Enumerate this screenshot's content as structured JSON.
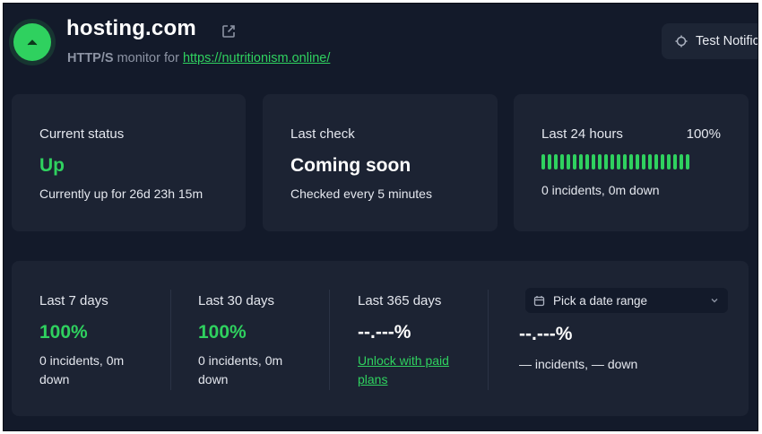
{
  "header": {
    "title": "hosting.com",
    "monitor_type": "HTTP/S",
    "monitor_for": "monitor for",
    "url": "https://nutritionism.online/",
    "test_button_label": "Test Notific"
  },
  "colors": {
    "up_green": "#2fd15f",
    "background": "#131a2a",
    "card": "#1c2333"
  },
  "icons": {
    "status": "chevron-up-icon",
    "external": "external-link-icon",
    "test": "bell-ring-icon",
    "calendar": "calendar-icon",
    "dropdown": "chevron-down-icon"
  },
  "current_status": {
    "label": "Current status",
    "value": "Up",
    "detail": "Currently up for 26d 23h 15m"
  },
  "last_check": {
    "label": "Last check",
    "value": "Coming soon",
    "detail": "Checked every 5 minutes"
  },
  "last_24h": {
    "label": "Last 24 hours",
    "percent": "100%",
    "bar_count": 24,
    "detail": "0 incidents, 0m down"
  },
  "stats": {
    "last7": {
      "label": "Last 7 days",
      "value": "100%",
      "detail_1": "0 incidents, 0m",
      "detail_2": "down"
    },
    "last30": {
      "label": "Last 30 days",
      "value": "100%",
      "detail_1": "0 incidents, 0m",
      "detail_2": "down"
    },
    "last365": {
      "label": "Last 365 days",
      "value": "--.---%",
      "link_1": "Unlock with paid",
      "link_2": "plans"
    },
    "custom": {
      "picker_label": "Pick a date range",
      "value": "--.---%",
      "detail": "— incidents, — down"
    }
  }
}
